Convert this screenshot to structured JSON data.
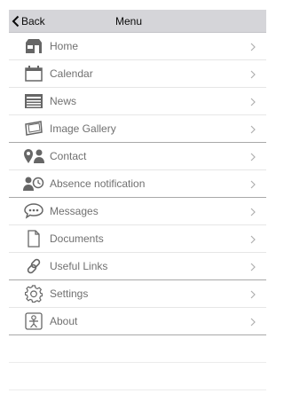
{
  "navbar": {
    "back_label": "Back",
    "title": "Menu"
  },
  "menu": {
    "items": [
      {
        "label": "Home",
        "icon": "home-icon"
      },
      {
        "label": "Calendar",
        "icon": "calendar-icon"
      },
      {
        "label": "News",
        "icon": "news-icon"
      },
      {
        "label": "Image Gallery",
        "icon": "image-gallery-icon"
      },
      {
        "label": "Contact",
        "icon": "contact-icon"
      },
      {
        "label": "Absence notification",
        "icon": "absence-notification-icon"
      },
      {
        "label": "Messages",
        "icon": "messages-icon"
      },
      {
        "label": "Documents",
        "icon": "documents-icon"
      },
      {
        "label": "Useful Links",
        "icon": "useful-links-icon"
      },
      {
        "label": "Settings",
        "icon": "settings-icon"
      },
      {
        "label": "About",
        "icon": "about-icon"
      }
    ]
  },
  "colors": {
    "navbar_bg": "#d5d5d9",
    "text": "#707070",
    "icon": "#666666",
    "chevron": "#b0b0b0"
  }
}
